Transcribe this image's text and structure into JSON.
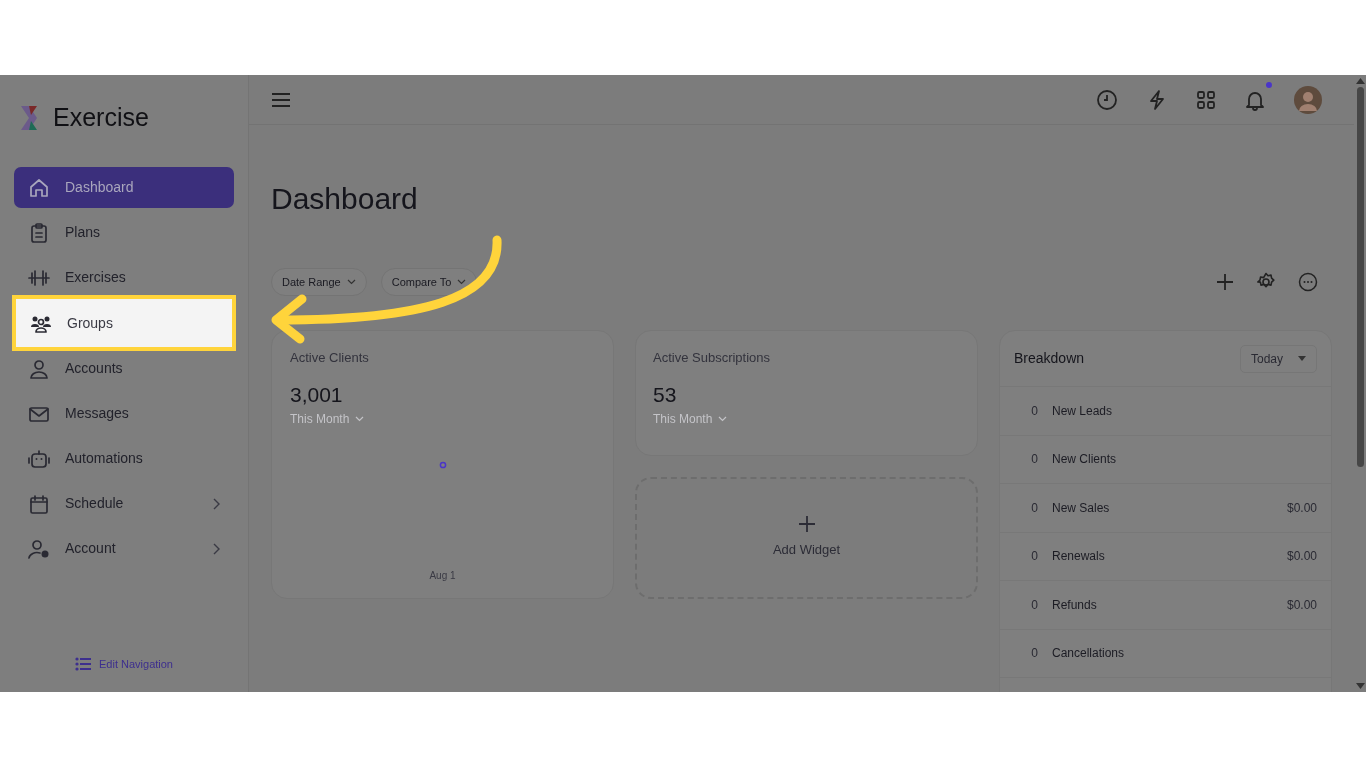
{
  "sidebar": {
    "logo_text": "Exercise",
    "items": [
      {
        "label": "Dashboard",
        "selected": true,
        "highlighted": false,
        "has_submenu": false
      },
      {
        "label": "Plans",
        "selected": false,
        "highlighted": false,
        "has_submenu": false
      },
      {
        "label": "Exercises",
        "selected": false,
        "highlighted": false,
        "has_submenu": false
      },
      {
        "label": "Groups",
        "selected": false,
        "highlighted": true,
        "has_submenu": false
      },
      {
        "label": "Accounts",
        "selected": false,
        "highlighted": false,
        "has_submenu": false
      },
      {
        "label": "Messages",
        "selected": false,
        "highlighted": false,
        "has_submenu": false
      },
      {
        "label": "Automations",
        "selected": false,
        "highlighted": false,
        "has_submenu": false
      },
      {
        "label": "Schedule",
        "selected": false,
        "highlighted": false,
        "has_submenu": true
      },
      {
        "label": "Account",
        "selected": false,
        "highlighted": false,
        "has_submenu": true
      }
    ],
    "edit_navigation": "Edit Navigation"
  },
  "topbar": {
    "notification_dot": true
  },
  "page": {
    "title": "Dashboard",
    "filters": [
      "Date Range",
      "Compare To"
    ],
    "cards": [
      {
        "title": "Active Clients",
        "value": "3,001",
        "period": "This Month",
        "chart_label": "Aug 1"
      },
      {
        "title": "Active Subscriptions",
        "value": "53",
        "period": "This Month"
      }
    ],
    "add_widget": "Add Widget",
    "breakdown": {
      "title": "Breakdown",
      "range": "Today",
      "rows": [
        {
          "count": "0",
          "label": "New Leads"
        },
        {
          "count": "0",
          "label": "New Clients"
        },
        {
          "count": "0",
          "label": "New Sales",
          "amount": "$0.00"
        },
        {
          "count": "0",
          "label": "Renewals",
          "amount": "$0.00"
        },
        {
          "count": "0",
          "label": "Refunds",
          "amount": "$0.00"
        },
        {
          "count": "0",
          "label": "Cancellations"
        }
      ]
    }
  }
}
